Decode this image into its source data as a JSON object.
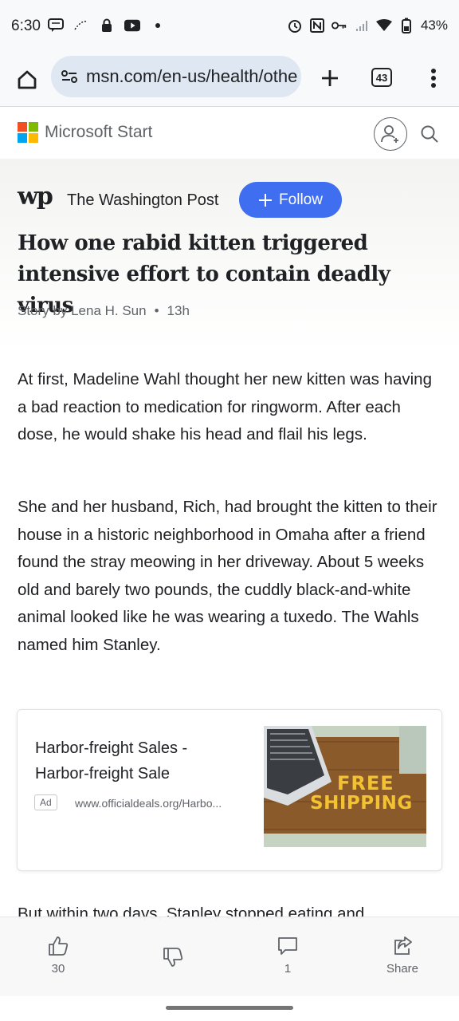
{
  "status_bar": {
    "time": "6:30",
    "battery": "43%"
  },
  "browser": {
    "url": "msn.com/en-us/health/othe",
    "tab_count": "43"
  },
  "site": {
    "brand": "Microsoft Start",
    "logo_colors": [
      "#f25022",
      "#7fba00",
      "#00a4ef",
      "#ffb900"
    ]
  },
  "article": {
    "publisher_logo": "wp",
    "publisher": "The Washington Post",
    "follow_label": "Follow",
    "title": "How one rabid kitten triggered intensive effort to contain deadly virus",
    "author": "Story by Lena H. Sun",
    "separator": "•",
    "time_ago": "13h",
    "paragraphs": [
      "At first, Madeline Wahl thought her new kitten was having a bad reaction to medication for ringworm. After each dose, he would shake his head and flail his legs.",
      "She and her husband, Rich, had brought the kitten to their house in a historic neighborhood in Omaha after a friend found the stray meowing in her driveway. About 5 weeks old and barely two pounds, the cuddly black-and-white animal looked like he was wearing a tuxedo. The Wahls named him Stanley.",
      "But within two days, Stanley stopped eating and"
    ]
  },
  "ad": {
    "title": "Harbor-freight Sales - Harbor-freight Sale",
    "badge": "Ad",
    "url": "www.officialdeals.org/Harbo...",
    "image_text_1": "FREE",
    "image_text_2": "SHIPPING"
  },
  "actions": {
    "like_count": "30",
    "comment_count": "1",
    "share_label": "Share"
  }
}
